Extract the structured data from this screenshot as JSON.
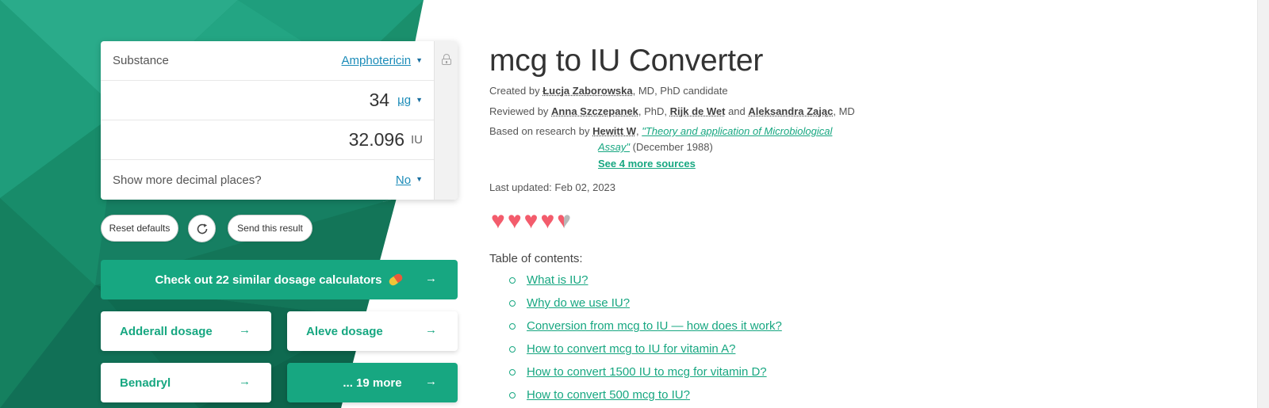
{
  "calculator": {
    "substance_label": "Substance",
    "substance_value": "Amphotericin",
    "mass_value": "34",
    "mass_unit": "µg",
    "iu_value": "32.096",
    "iu_unit": "IU",
    "decimal_label": "Show more decimal places?",
    "decimal_value": "No"
  },
  "actions": {
    "reset": "Reset defaults",
    "send": "Send this result"
  },
  "similar": {
    "main": "Check out 22 similar dosage calculators",
    "tiles": [
      "Adderall dosage",
      "Aleve dosage",
      "Benadryl",
      "... 19 more"
    ]
  },
  "article": {
    "title": "mcg to IU Converter",
    "created_prefix": "Created by ",
    "created_author": "Łucja Zaborowska",
    "created_suffix": ", MD, PhD candidate",
    "reviewed_prefix": "Reviewed by ",
    "reviewer1": "Anna Szczepanek",
    "reviewer1_suffix": ", PhD, ",
    "reviewer2": "Rijk de Wet",
    "reviewed_and": " and ",
    "reviewer3": "Aleksandra Zając",
    "reviewer3_suffix": ", MD",
    "based_prefix": "Based on research by ",
    "research_author": "Hewitt W",
    "research_comma": ", ",
    "research_title_line1": "\"Theory and application of Microbiological",
    "research_title_line2": "Assay\"",
    "research_date": " (December 1988)",
    "more_sources": "See 4 more sources",
    "last_updated": "Last updated: Feb 02, 2023",
    "rating": 4.5,
    "toc_title": "Table of contents:",
    "toc": [
      "What is IU?",
      "Why do we use IU?",
      "Conversion from mcg to IU — how does it work?",
      "How to convert mcg to IU for vitamin A?",
      "How to convert 1500 IU to mcg for vitamin D?",
      "How to convert 500 mcg to IU?"
    ]
  },
  "colors": {
    "brand_green": "#17a781",
    "heart": "#f35c6c",
    "link_blue": "#1a8bb8"
  }
}
